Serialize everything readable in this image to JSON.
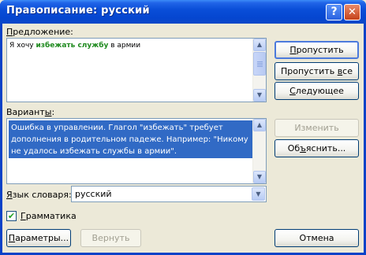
{
  "window": {
    "title": "Правописание: русский",
    "help_glyph": "?",
    "close_glyph": "✕"
  },
  "sentence": {
    "label_prefix": "",
    "label_access": "П",
    "label_rest": "редложение:",
    "text_before": "Я хочу ",
    "text_error": "избежать службу",
    "text_after": " в армии"
  },
  "variants": {
    "label_prefix": "Вариант",
    "label_access": "ы",
    "label_rest": ":",
    "selected_text": "Ошибка в управлении. Глагол \"избежать\" требует дополнения в родительном падеже. Например: \"Никому не удалось избежать службы в армии\"."
  },
  "dictionary": {
    "label_prefix": "",
    "label_access": "Я",
    "label_rest": "зык словаря:",
    "value": "русский"
  },
  "grammar": {
    "checked": true,
    "check_glyph": "✔",
    "label_prefix": "",
    "label_access": "Г",
    "label_rest": "рамматика"
  },
  "buttons": {
    "skip": {
      "prefix": "",
      "access": "П",
      "rest": "ропустить"
    },
    "skip_all": {
      "prefix": "Пропустить ",
      "access": "в",
      "rest": "се"
    },
    "next": {
      "prefix": "",
      "access": "С",
      "rest": "ледующее"
    },
    "change": "Изменить",
    "explain": {
      "prefix": "Об",
      "access": "ъ",
      "rest": "яснить..."
    },
    "options": {
      "prefix": "",
      "access": "П",
      "rest": "араметры..."
    },
    "undo": "Вернуть",
    "cancel": "Отмена"
  },
  "icons": {
    "scroll_up": "▲",
    "scroll_down": "▼",
    "dropdown": "▼"
  }
}
